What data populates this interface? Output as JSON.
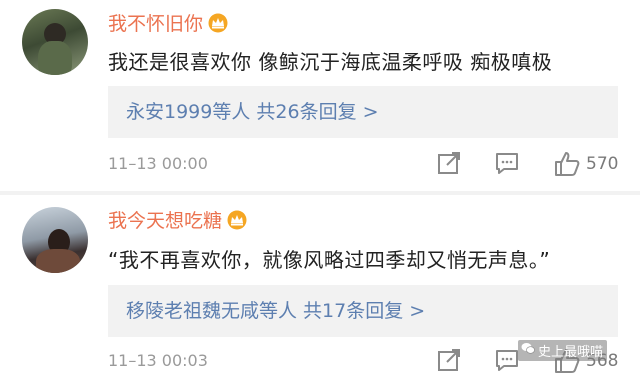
{
  "comments": [
    {
      "username": "我不怀旧你",
      "text": "我还是很喜欢你 像鲸沉于海底温柔呼吸  痴极嗔极",
      "replies_summary": "永安1999等人  共26条回复 >",
      "time": "11–13 00:00",
      "likes": "570"
    },
    {
      "username": "我今天想吃糖",
      "text": "“我不再喜欢你，就像风略过四季却又悄无声息。”",
      "replies_summary": "移陵老祖魏无咸等人  共17条回复 >",
      "time": "11–13 00:03",
      "likes": "568"
    }
  ],
  "watermark": "史上最哦喵",
  "colors": {
    "username": "#eb7350",
    "reply_link": "#5d7fb0",
    "crown": "#f5a623"
  }
}
